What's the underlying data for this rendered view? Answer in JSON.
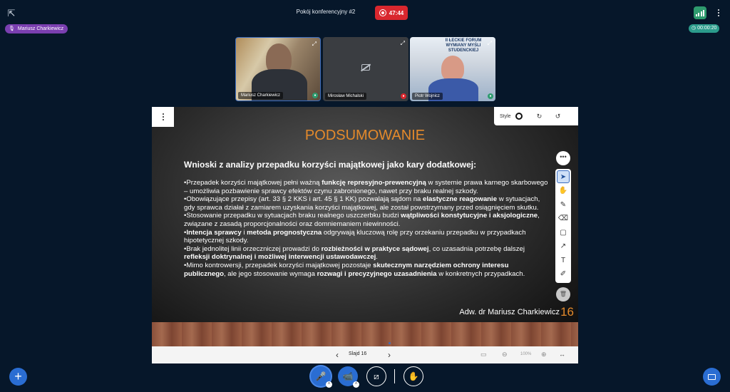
{
  "header": {
    "room_title": "Pokój konferencyjny #2",
    "recording_time": "47:44",
    "user_name": "Mariusz Charkiewicz",
    "session_timer": "00:00:20"
  },
  "videos": [
    {
      "name": "Mariusz Charkiewicz",
      "mic": "on"
    },
    {
      "name": "Mirosław Michalski",
      "mic": "off"
    },
    {
      "name": "Piotr Wojnicz",
      "mic": "on"
    }
  ],
  "tile3_banner": {
    "line1": "II ŁECKIE FORUM",
    "line2": "WYMIANY MYŚLI",
    "line3": "STUDENCKIEJ"
  },
  "slide": {
    "title": "PODSUMOWANIE",
    "subtitle": "Wnioski z analizy przepadku korzyści majątkowej jako kary dodatkowej:",
    "author": "Adw. dr Mariusz Charkiewicz",
    "number": "16",
    "p1_a": "•Przepadek korzyści majątkowej pełni ważną ",
    "p1_b": "funkcję represyjno-prewencyjną",
    "p1_c": " w systemie prawa karnego skarbowego – umożliwia pozbawienie sprawcy efektów czynu zabronionego, nawet przy braku realnej szkody.",
    "p2_a": "•Obowiązujące przepisy (art. 33 § 2 KKS i art. 45 § 1 KK) pozwalają sądom na ",
    "p2_b": "elastyczne reagowanie",
    "p2_c": " w sytuacjach, gdy sprawca działał z zamiarem uzyskania korzyści majątkowej, ale został powstrzymany przed osiągnięciem skutku.",
    "p3_a": "•Stosowanie przepadku w sytuacjach braku realnego uszczerbku budzi ",
    "p3_b": "wątpliwości konstytucyjne i aksjologiczne",
    "p3_c": ", związane z zasadą proporcjonalności oraz domniemaniem niewinności.",
    "p4_a": "•",
    "p4_b": "Intencja sprawcy",
    "p4_c": " i ",
    "p4_d": "metoda prognostyczna",
    "p4_e": " odgrywają kluczową rolę przy orzekaniu przepadku w przypadkach hipotetycznej szkody.",
    "p5_a": "•Brak jednolitej linii orzeczniczej prowadzi do ",
    "p5_b": "rozbieżności w praktyce sądowej",
    "p5_c": ", co uzasadnia potrzebę dalszej ",
    "p5_d": "refleksji doktrynalnej i możliwej interwencji ustawodawczej",
    "p5_e": ".",
    "p6_a": "•Mimo kontrowersji, przepadek korzyści majątkowej pozostaje ",
    "p6_b": "skutecznym narzędziem ochrony interesu publicznego",
    "p6_c": ", ale jego stosowanie wymaga ",
    "p6_d": "rozwagi i precyzyjnego uzasadnienia",
    "p6_e": " w konkretnych przypadkach."
  },
  "whiteboard": {
    "style_label": "Style",
    "tools": [
      "select",
      "hand",
      "pencil",
      "eraser",
      "rectangle",
      "arrow",
      "text",
      "note"
    ]
  },
  "navigation": {
    "slide_label": "Slajd 16",
    "zoom": "100%"
  }
}
